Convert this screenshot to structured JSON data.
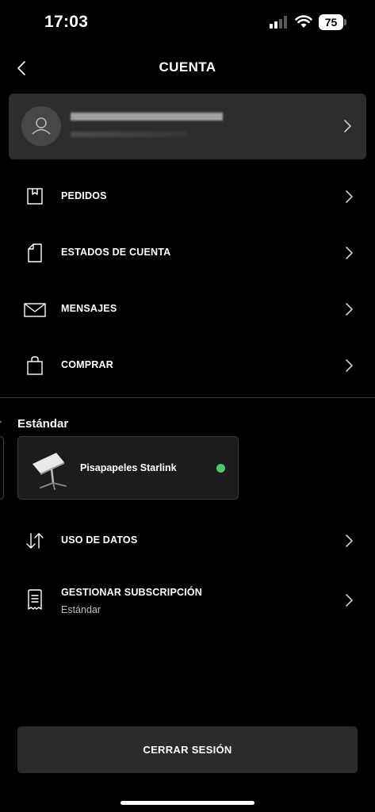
{
  "status_bar": {
    "time": "17:03",
    "battery": "75"
  },
  "header": {
    "title": "CUENTA"
  },
  "menu": [
    {
      "label": "PEDIDOS",
      "icon": "box-icon"
    },
    {
      "label": "ESTADOS DE CUENTA",
      "icon": "document-icon"
    },
    {
      "label": "MENSAJES",
      "icon": "envelope-icon"
    },
    {
      "label": "COMPRAR",
      "icon": "shopping-bag-icon"
    }
  ],
  "plan": {
    "section_title": "Estándar",
    "peek_text": "r",
    "device_name": "Pisapapeles Starlink",
    "status_color": "#51c56a"
  },
  "plan_menu": {
    "data_usage": "USO DE DATOS",
    "subscription": "GESTIONAR SUBSCRIPCIÓN",
    "subscription_sub": "Estándar"
  },
  "logout_label": "CERRAR SESIÓN"
}
